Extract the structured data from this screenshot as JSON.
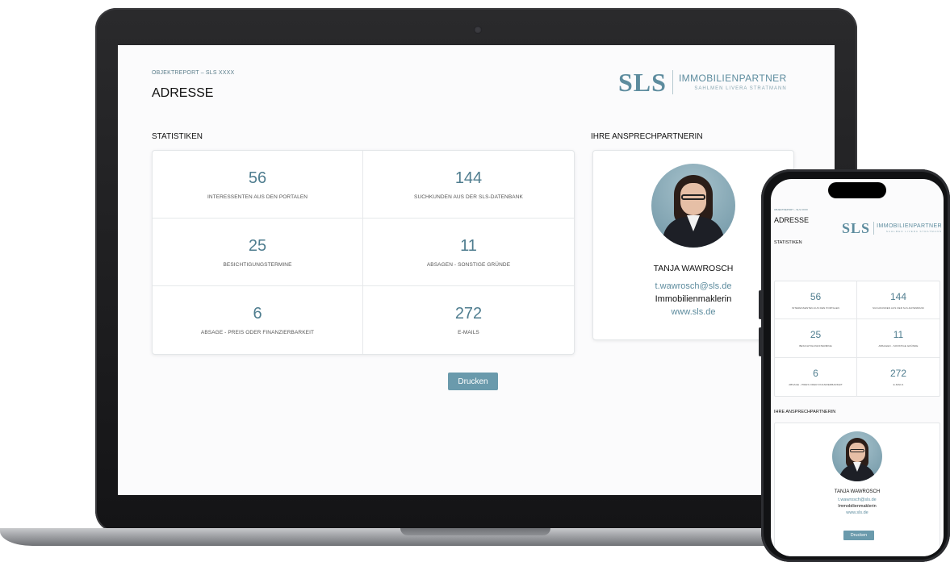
{
  "desktop": {
    "breadcrumb": "OBJEKTREPORT – SLS XXXX",
    "title": "ADRESSE",
    "logo": {
      "mark": "SLS",
      "name": "IMMOBILIENPARTNER",
      "tagline": "SAHLMEN LIVERA STRATMANN"
    },
    "stats_heading": "STATISTIKEN",
    "contact_heading": "IHRE ANSPRECHPARTNERIN",
    "stats": [
      {
        "value": "56",
        "label": "INTERESSENTEN AUS DEN PORTALEN"
      },
      {
        "value": "144",
        "label": "SUCHKUNDEN AUS DER SLS-DATENBANK"
      },
      {
        "value": "25",
        "label": "BESICHTIGUNGSTERMINE"
      },
      {
        "value": "11",
        "label": "ABSAGEN - SONSTIGE GRÜNDE"
      },
      {
        "value": "6",
        "label": "ABSAGE - PREIS ODER FINANZIERBARKEIT"
      },
      {
        "value": "272",
        "label": "E-MAILS"
      }
    ],
    "contact": {
      "name": "TANJA WAWROSCH",
      "email": "t.wawrosch@sls.de",
      "role": "Immobilienmaklerin",
      "website": "www.sls.de"
    },
    "print_label": "Drucken"
  },
  "mobile": {
    "breadcrumb": "OBJEKTREPORT – SLS XXXX",
    "title": "ADRESSE",
    "logo": {
      "mark": "SLS",
      "name": "IMMOBILIENPARTNER",
      "tagline": "SAHLMEN LIVERA STRATMANN"
    },
    "stats_heading": "STATISTIKEN",
    "contact_heading": "IHRE ANSPRECHPARTNERIN",
    "stats": [
      {
        "value": "56",
        "label": "INTERESSENTEN AUS DEN PORTALEN"
      },
      {
        "value": "144",
        "label": "SUCHKUNDEN AUS DER SLS-DATENBANK"
      },
      {
        "value": "25",
        "label": "BESICHTIGUNGSTERMINE"
      },
      {
        "value": "11",
        "label": "ABSAGEN - SONSTIGE GRÜNDE"
      },
      {
        "value": "6",
        "label": "ABSAGE - PREIS ODER FINANZIERBARKEIT"
      },
      {
        "value": "272",
        "label": "E-MAILS"
      }
    ],
    "contact": {
      "name": "TANJA WAWROSCH",
      "email": "t.wawrosch@sls.de",
      "role": "Immobilienmaklerin",
      "website": "www.sls.de"
    },
    "print_label": "Drucken"
  },
  "colors": {
    "accent": "#5d8c9e",
    "button": "#6a9aac",
    "device_frame": "#141416"
  }
}
